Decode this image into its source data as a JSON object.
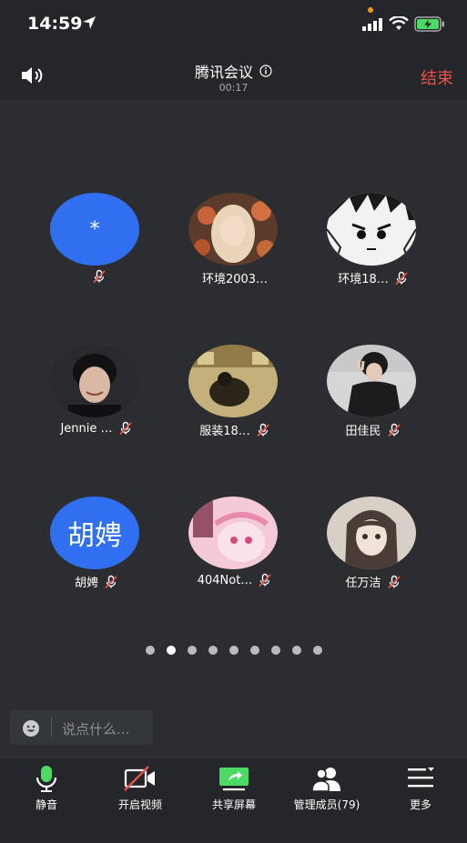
{
  "status_bar": {
    "time": "14:59"
  },
  "header": {
    "title": "腾讯会议",
    "timer": "00:17",
    "end_label": "结束"
  },
  "participants": [
    {
      "name": "",
      "avatar_text": "*",
      "avatar": "letter",
      "muted": true
    },
    {
      "name": "环境2003…",
      "avatar": "photo-blonde-girl",
      "muted": false
    },
    {
      "name": "环境18…",
      "avatar": "anime-sketch",
      "muted": true
    },
    {
      "name": "Jennie …",
      "avatar": "photo-smiling-boy",
      "muted": true
    },
    {
      "name": "服装18…",
      "avatar": "photo-sitting-person",
      "muted": true
    },
    {
      "name": "田佳民",
      "avatar": "photo-peace-sign",
      "muted": true
    },
    {
      "name": "胡娉",
      "avatar_text": "胡娉",
      "avatar": "letter",
      "muted": true
    },
    {
      "name": "404Not…",
      "avatar": "pink-anime",
      "muted": true
    },
    {
      "name": "任万洁",
      "avatar": "anime-girl-sketch",
      "muted": true
    }
  ],
  "pagination": {
    "total": 9,
    "current": 2
  },
  "chat": {
    "placeholder": "说点什么..."
  },
  "toolbar": {
    "items": [
      {
        "label": "静音",
        "icon": "microphone-icon"
      },
      {
        "label": "开启视频",
        "icon": "video-off-icon"
      },
      {
        "label": "共享屏幕",
        "icon": "share-screen-icon"
      },
      {
        "label": "管理成员(79)",
        "icon": "members-icon"
      },
      {
        "label": "更多",
        "icon": "more-menu-icon"
      }
    ]
  },
  "colors": {
    "accent_blue": "#2f6ff0",
    "end_red": "#e8524a",
    "mic_green": "#4cd964"
  }
}
